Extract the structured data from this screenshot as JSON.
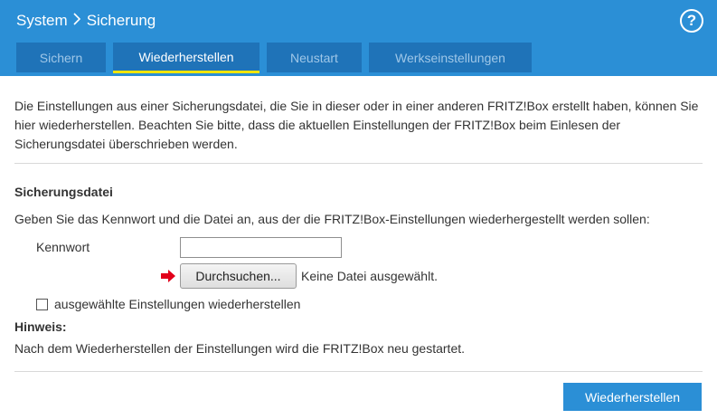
{
  "header": {
    "breadcrumb": [
      "System",
      "Sicherung"
    ],
    "help_symbol": "?"
  },
  "tabs": [
    {
      "label": "Sichern",
      "active": false
    },
    {
      "label": "Wiederherstellen",
      "active": true
    },
    {
      "label": "Neustart",
      "active": false
    },
    {
      "label": "Werkseinstellungen",
      "active": false
    }
  ],
  "main": {
    "intro": "Die Einstellungen aus einer Sicherungsdatei, die Sie in dieser oder in einer anderen FRITZ!Box erstellt haben, können Sie hier wiederherstellen. Beachten Sie bitte, dass die aktuellen Einstellungen der FRITZ!Box beim Einlesen der Sicherungsdatei überschrieben werden.",
    "section_title": "Sicherungsdatei",
    "instructions": "Geben Sie das Kennwort und die Datei an, aus der die FRITZ!Box-Einstellungen wiederhergestellt werden sollen:",
    "password_label": "Kennwort",
    "password_value": "",
    "browse_button": "Durchsuchen...",
    "file_status": "Keine Datei ausgewählt.",
    "checkbox_label": "ausgewählte Einstellungen wiederherstellen",
    "checkbox_checked": false,
    "note_title": "Hinweis:",
    "note_text": "Nach dem Wiederherstellen der Einstellungen wird die FRITZ!Box neu gestartet."
  },
  "footer": {
    "submit_button": "Wiederherstellen"
  },
  "icons": {
    "arrow": "right-arrow-icon"
  },
  "colors": {
    "header_blue": "#2b8fd6",
    "tab_blue": "#1f73b8",
    "active_tab_underline": "#f0e500",
    "arrow_red": "#e2001a"
  }
}
